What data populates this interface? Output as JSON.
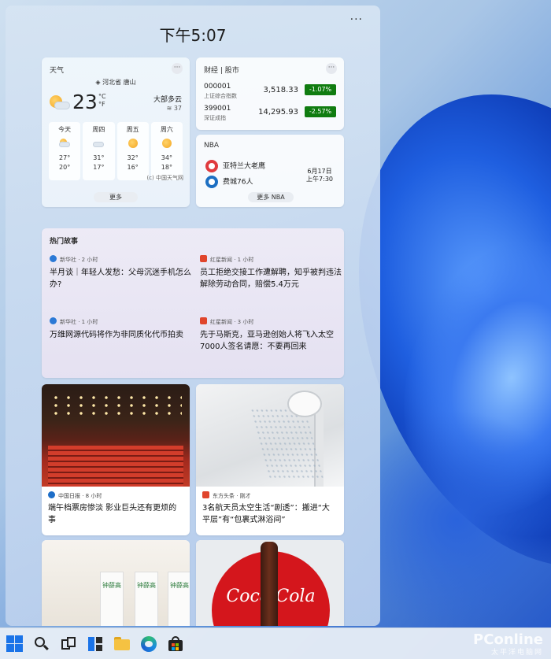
{
  "panel": {
    "clock": "下午5:07",
    "more": "···"
  },
  "weather": {
    "title": "天气",
    "more": "···",
    "location": "河北省 唐山",
    "temp": "23",
    "unit_c": "°C",
    "unit_f": "°F",
    "condition": "大部多云",
    "humidity": "37",
    "forecast": [
      {
        "day": "今天",
        "icon": "partly-cloudy-icon",
        "hi": "27°",
        "lo": "20°"
      },
      {
        "day": "周四",
        "icon": "cloud-icon",
        "hi": "31°",
        "lo": "17°"
      },
      {
        "day": "周五",
        "icon": "sun-icon",
        "hi": "32°",
        "lo": "16°"
      },
      {
        "day": "周六",
        "icon": "sun-icon",
        "hi": "34°",
        "lo": "18°"
      }
    ],
    "more_button": "更多",
    "credit": "(c) 中国天气网"
  },
  "finance": {
    "title": "财经 | 股市",
    "more": "···",
    "stocks": [
      {
        "code": "000001",
        "name": "上证综合指数",
        "price": "3,518.33",
        "change": "-1.07%"
      },
      {
        "code": "399001",
        "name": "深证成指",
        "price": "14,295.93",
        "change": "-2.57%"
      }
    ],
    "accent_down": "#107c10"
  },
  "nba": {
    "title": "NBA",
    "team1": "亚特兰大老鹰",
    "team2": "费城76人",
    "date": "6月17日",
    "time": "上午7:30",
    "more_button": "更多 NBA"
  },
  "hot": {
    "title": "热门故事",
    "stories": [
      {
        "source": "新华社 · 2 小时",
        "title": "半月谈｜年轻人发愁：父母沉迷手机怎么办?"
      },
      {
        "source": "红星新闻 · 1 小时",
        "title": "员工拒绝交接工作遭解聘，知乎被判违法解除劳动合同，赔偿5.4万元"
      },
      {
        "source": "新华社 · 1 小时",
        "title": "万维网源代码将作为非同质化代币拍卖"
      },
      {
        "source": "红星新闻 · 3 小时",
        "title": "先于马斯克，亚马逊创始人将飞入太空 7000人签名请愿：不要再回来"
      }
    ]
  },
  "cards": {
    "cinema": {
      "source": "中国日报 · 8 小时",
      "title": "端午档票房惨淡 影业巨头还有更烦的事"
    },
    "shower": {
      "source": "东方头条 · 刚才",
      "title": "3名航天员太空生活“剧透”：搬进“大平层”有“包裹式淋浴间”"
    },
    "rice": {
      "bag_label": "钟薛高"
    },
    "coke": {
      "logo_text": "Coca-Cola"
    }
  },
  "taskbar": {
    "watermark": "PConline",
    "watermark_sub": "太平洋电脑网"
  }
}
